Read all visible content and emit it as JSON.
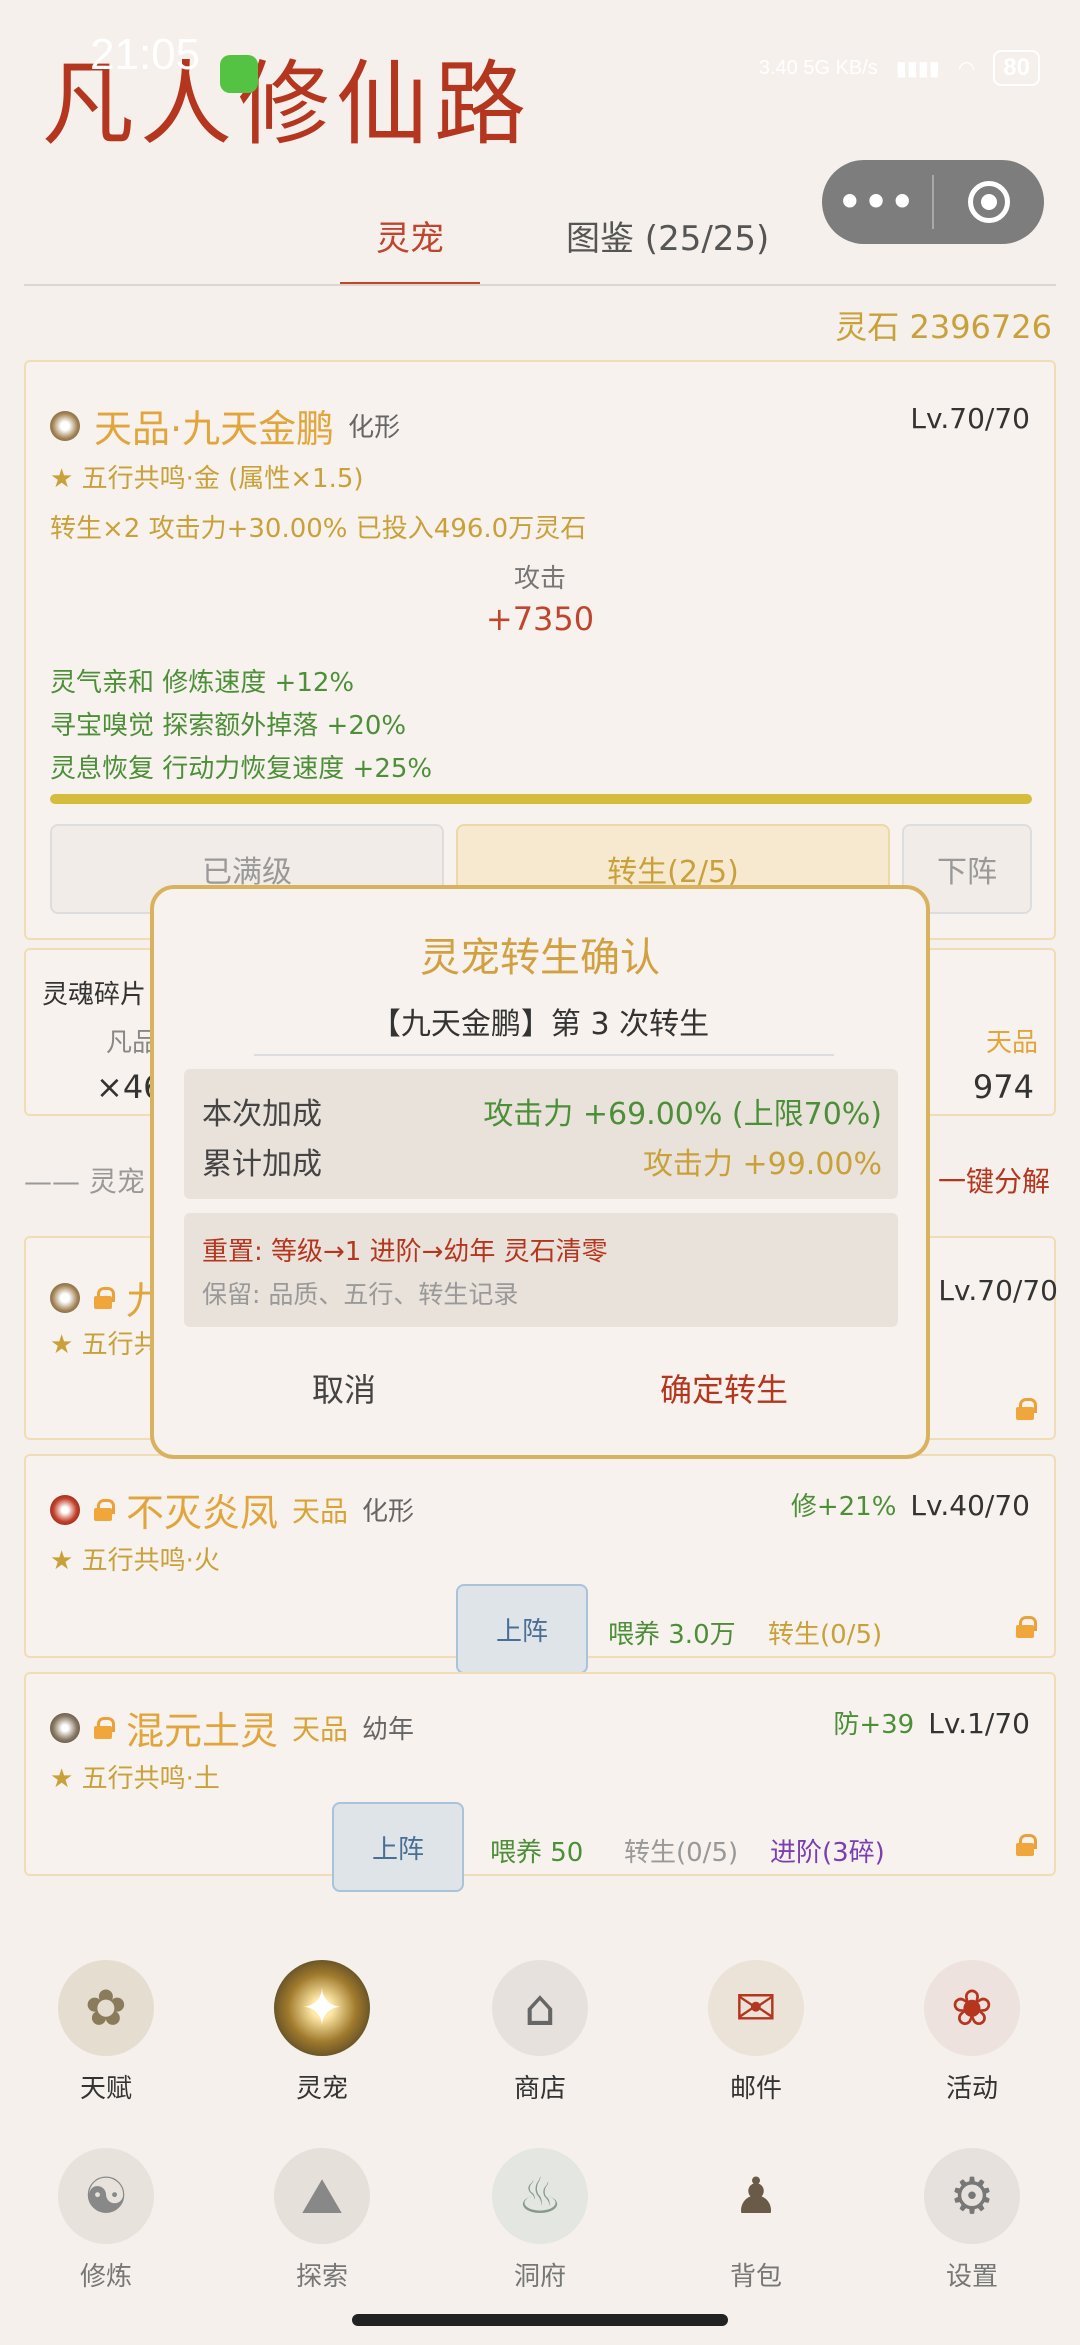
{
  "status_bar": {
    "time": "21:05",
    "net_speed": "3.40 5G KB/s",
    "battery": "80"
  },
  "app": {
    "title": "凡人修仙路"
  },
  "tabs": [
    {
      "label": "灵宠"
    },
    {
      "label": "图鉴 (25/25)"
    }
  ],
  "stone": "灵石 2396726",
  "main_pet": {
    "name": "天品·九天金鹏",
    "stage": "化形",
    "level": "Lv.70/70",
    "resonance": "★ 五行共鸣·金 (属性×1.5)",
    "rebirth_line": "转生×2  攻击力+30.00%  已投入496.0万灵石",
    "attack_label": "攻击",
    "attack_value": "+7350",
    "skills": [
      "灵气亲和 修炼速度 +12%",
      "寻宝嗅觉 探索额外掉落 +20%",
      "灵息恢复 行动力恢复速度 +25%"
    ],
    "btn_maxed": "已满级",
    "btn_rebirth": "转生(2/5)",
    "btn_unequip": "下阵"
  },
  "soul_panel": {
    "label": "灵魂碎片",
    "col_left": "凡品",
    "val_left": "×46",
    "col_right": "天品",
    "val_right": "974"
  },
  "section": {
    "label": "—— 灵宠",
    "action": "一键分解"
  },
  "list": [
    {
      "name": "九",
      "level": "Lv.70/70",
      "resonance": "★ 五行共"
    },
    {
      "name": "不灭炎凤",
      "grade": "天品",
      "stage": "化形",
      "bonus": "修+21%",
      "level": "Lv.40/70",
      "resonance": "★ 五行共鸣·火",
      "deploy": "上阵",
      "feed": "喂养 3.0万",
      "rebirth": "转生(0/5)"
    },
    {
      "name": "混元土灵",
      "grade": "天品",
      "stage": "幼年",
      "bonus": "防+39",
      "level": "Lv.1/70",
      "resonance": "★ 五行共鸣·土",
      "deploy": "上阵",
      "feed": "喂养 50",
      "rebirth": "转生(0/5)",
      "advance": "进阶(3碎)"
    }
  ],
  "modal": {
    "title": "灵宠转生确认",
    "subtitle": "【九天金鹏】第 3 次转生",
    "this_label": "本次加成",
    "this_value": "攻击力 +69.00% (上限70%)",
    "total_label": "累计加成",
    "total_value": "攻击力 +99.00%",
    "reset_text": "重置: 等级→1  进阶→幼年  灵石清零",
    "keep_text": "保留: 品质、五行、转生记录",
    "cancel": "取消",
    "confirm": "确定转生"
  },
  "nav": [
    {
      "label": "天赋",
      "icon": "tree-icon"
    },
    {
      "label": "灵宠",
      "icon": "pet-orb-icon"
    },
    {
      "label": "商店",
      "icon": "shop-icon"
    },
    {
      "label": "邮件",
      "icon": "mail-icon"
    },
    {
      "label": "活动",
      "icon": "event-icon"
    },
    {
      "label": "修炼",
      "icon": "meditate-icon"
    },
    {
      "label": "探索",
      "icon": "mountain-icon"
    },
    {
      "label": "洞府",
      "icon": "cauldron-icon"
    },
    {
      "label": "背包",
      "icon": "bag-icon"
    },
    {
      "label": "设置",
      "icon": "gear-icon"
    }
  ],
  "colors": {
    "title_red": "#b5361f",
    "gold": "#c9a13a",
    "green": "#4d8f39",
    "purple": "#7a3fb0",
    "modal_border": "#d9b25f"
  }
}
